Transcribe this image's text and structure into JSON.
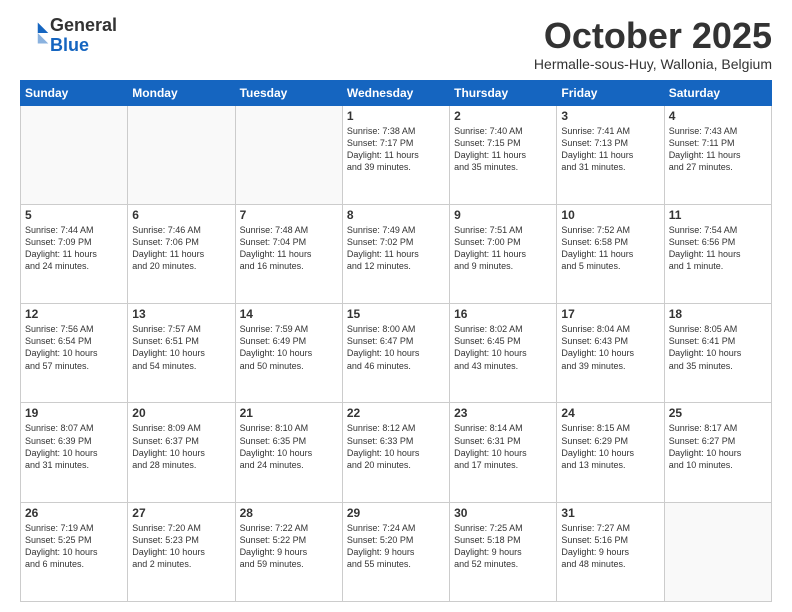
{
  "header": {
    "logo_general": "General",
    "logo_blue": "Blue",
    "month_title": "October 2025",
    "subtitle": "Hermalle-sous-Huy, Wallonia, Belgium"
  },
  "weekdays": [
    "Sunday",
    "Monday",
    "Tuesday",
    "Wednesday",
    "Thursday",
    "Friday",
    "Saturday"
  ],
  "weeks": [
    [
      {
        "day": "",
        "info": ""
      },
      {
        "day": "",
        "info": ""
      },
      {
        "day": "",
        "info": ""
      },
      {
        "day": "1",
        "info": "Sunrise: 7:38 AM\nSunset: 7:17 PM\nDaylight: 11 hours\nand 39 minutes."
      },
      {
        "day": "2",
        "info": "Sunrise: 7:40 AM\nSunset: 7:15 PM\nDaylight: 11 hours\nand 35 minutes."
      },
      {
        "day": "3",
        "info": "Sunrise: 7:41 AM\nSunset: 7:13 PM\nDaylight: 11 hours\nand 31 minutes."
      },
      {
        "day": "4",
        "info": "Sunrise: 7:43 AM\nSunset: 7:11 PM\nDaylight: 11 hours\nand 27 minutes."
      }
    ],
    [
      {
        "day": "5",
        "info": "Sunrise: 7:44 AM\nSunset: 7:09 PM\nDaylight: 11 hours\nand 24 minutes."
      },
      {
        "day": "6",
        "info": "Sunrise: 7:46 AM\nSunset: 7:06 PM\nDaylight: 11 hours\nand 20 minutes."
      },
      {
        "day": "7",
        "info": "Sunrise: 7:48 AM\nSunset: 7:04 PM\nDaylight: 11 hours\nand 16 minutes."
      },
      {
        "day": "8",
        "info": "Sunrise: 7:49 AM\nSunset: 7:02 PM\nDaylight: 11 hours\nand 12 minutes."
      },
      {
        "day": "9",
        "info": "Sunrise: 7:51 AM\nSunset: 7:00 PM\nDaylight: 11 hours\nand 9 minutes."
      },
      {
        "day": "10",
        "info": "Sunrise: 7:52 AM\nSunset: 6:58 PM\nDaylight: 11 hours\nand 5 minutes."
      },
      {
        "day": "11",
        "info": "Sunrise: 7:54 AM\nSunset: 6:56 PM\nDaylight: 11 hours\nand 1 minute."
      }
    ],
    [
      {
        "day": "12",
        "info": "Sunrise: 7:56 AM\nSunset: 6:54 PM\nDaylight: 10 hours\nand 57 minutes."
      },
      {
        "day": "13",
        "info": "Sunrise: 7:57 AM\nSunset: 6:51 PM\nDaylight: 10 hours\nand 54 minutes."
      },
      {
        "day": "14",
        "info": "Sunrise: 7:59 AM\nSunset: 6:49 PM\nDaylight: 10 hours\nand 50 minutes."
      },
      {
        "day": "15",
        "info": "Sunrise: 8:00 AM\nSunset: 6:47 PM\nDaylight: 10 hours\nand 46 minutes."
      },
      {
        "day": "16",
        "info": "Sunrise: 8:02 AM\nSunset: 6:45 PM\nDaylight: 10 hours\nand 43 minutes."
      },
      {
        "day": "17",
        "info": "Sunrise: 8:04 AM\nSunset: 6:43 PM\nDaylight: 10 hours\nand 39 minutes."
      },
      {
        "day": "18",
        "info": "Sunrise: 8:05 AM\nSunset: 6:41 PM\nDaylight: 10 hours\nand 35 minutes."
      }
    ],
    [
      {
        "day": "19",
        "info": "Sunrise: 8:07 AM\nSunset: 6:39 PM\nDaylight: 10 hours\nand 31 minutes."
      },
      {
        "day": "20",
        "info": "Sunrise: 8:09 AM\nSunset: 6:37 PM\nDaylight: 10 hours\nand 28 minutes."
      },
      {
        "day": "21",
        "info": "Sunrise: 8:10 AM\nSunset: 6:35 PM\nDaylight: 10 hours\nand 24 minutes."
      },
      {
        "day": "22",
        "info": "Sunrise: 8:12 AM\nSunset: 6:33 PM\nDaylight: 10 hours\nand 20 minutes."
      },
      {
        "day": "23",
        "info": "Sunrise: 8:14 AM\nSunset: 6:31 PM\nDaylight: 10 hours\nand 17 minutes."
      },
      {
        "day": "24",
        "info": "Sunrise: 8:15 AM\nSunset: 6:29 PM\nDaylight: 10 hours\nand 13 minutes."
      },
      {
        "day": "25",
        "info": "Sunrise: 8:17 AM\nSunset: 6:27 PM\nDaylight: 10 hours\nand 10 minutes."
      }
    ],
    [
      {
        "day": "26",
        "info": "Sunrise: 7:19 AM\nSunset: 5:25 PM\nDaylight: 10 hours\nand 6 minutes."
      },
      {
        "day": "27",
        "info": "Sunrise: 7:20 AM\nSunset: 5:23 PM\nDaylight: 10 hours\nand 2 minutes."
      },
      {
        "day": "28",
        "info": "Sunrise: 7:22 AM\nSunset: 5:22 PM\nDaylight: 9 hours\nand 59 minutes."
      },
      {
        "day": "29",
        "info": "Sunrise: 7:24 AM\nSunset: 5:20 PM\nDaylight: 9 hours\nand 55 minutes."
      },
      {
        "day": "30",
        "info": "Sunrise: 7:25 AM\nSunset: 5:18 PM\nDaylight: 9 hours\nand 52 minutes."
      },
      {
        "day": "31",
        "info": "Sunrise: 7:27 AM\nSunset: 5:16 PM\nDaylight: 9 hours\nand 48 minutes."
      },
      {
        "day": "",
        "info": ""
      }
    ]
  ]
}
